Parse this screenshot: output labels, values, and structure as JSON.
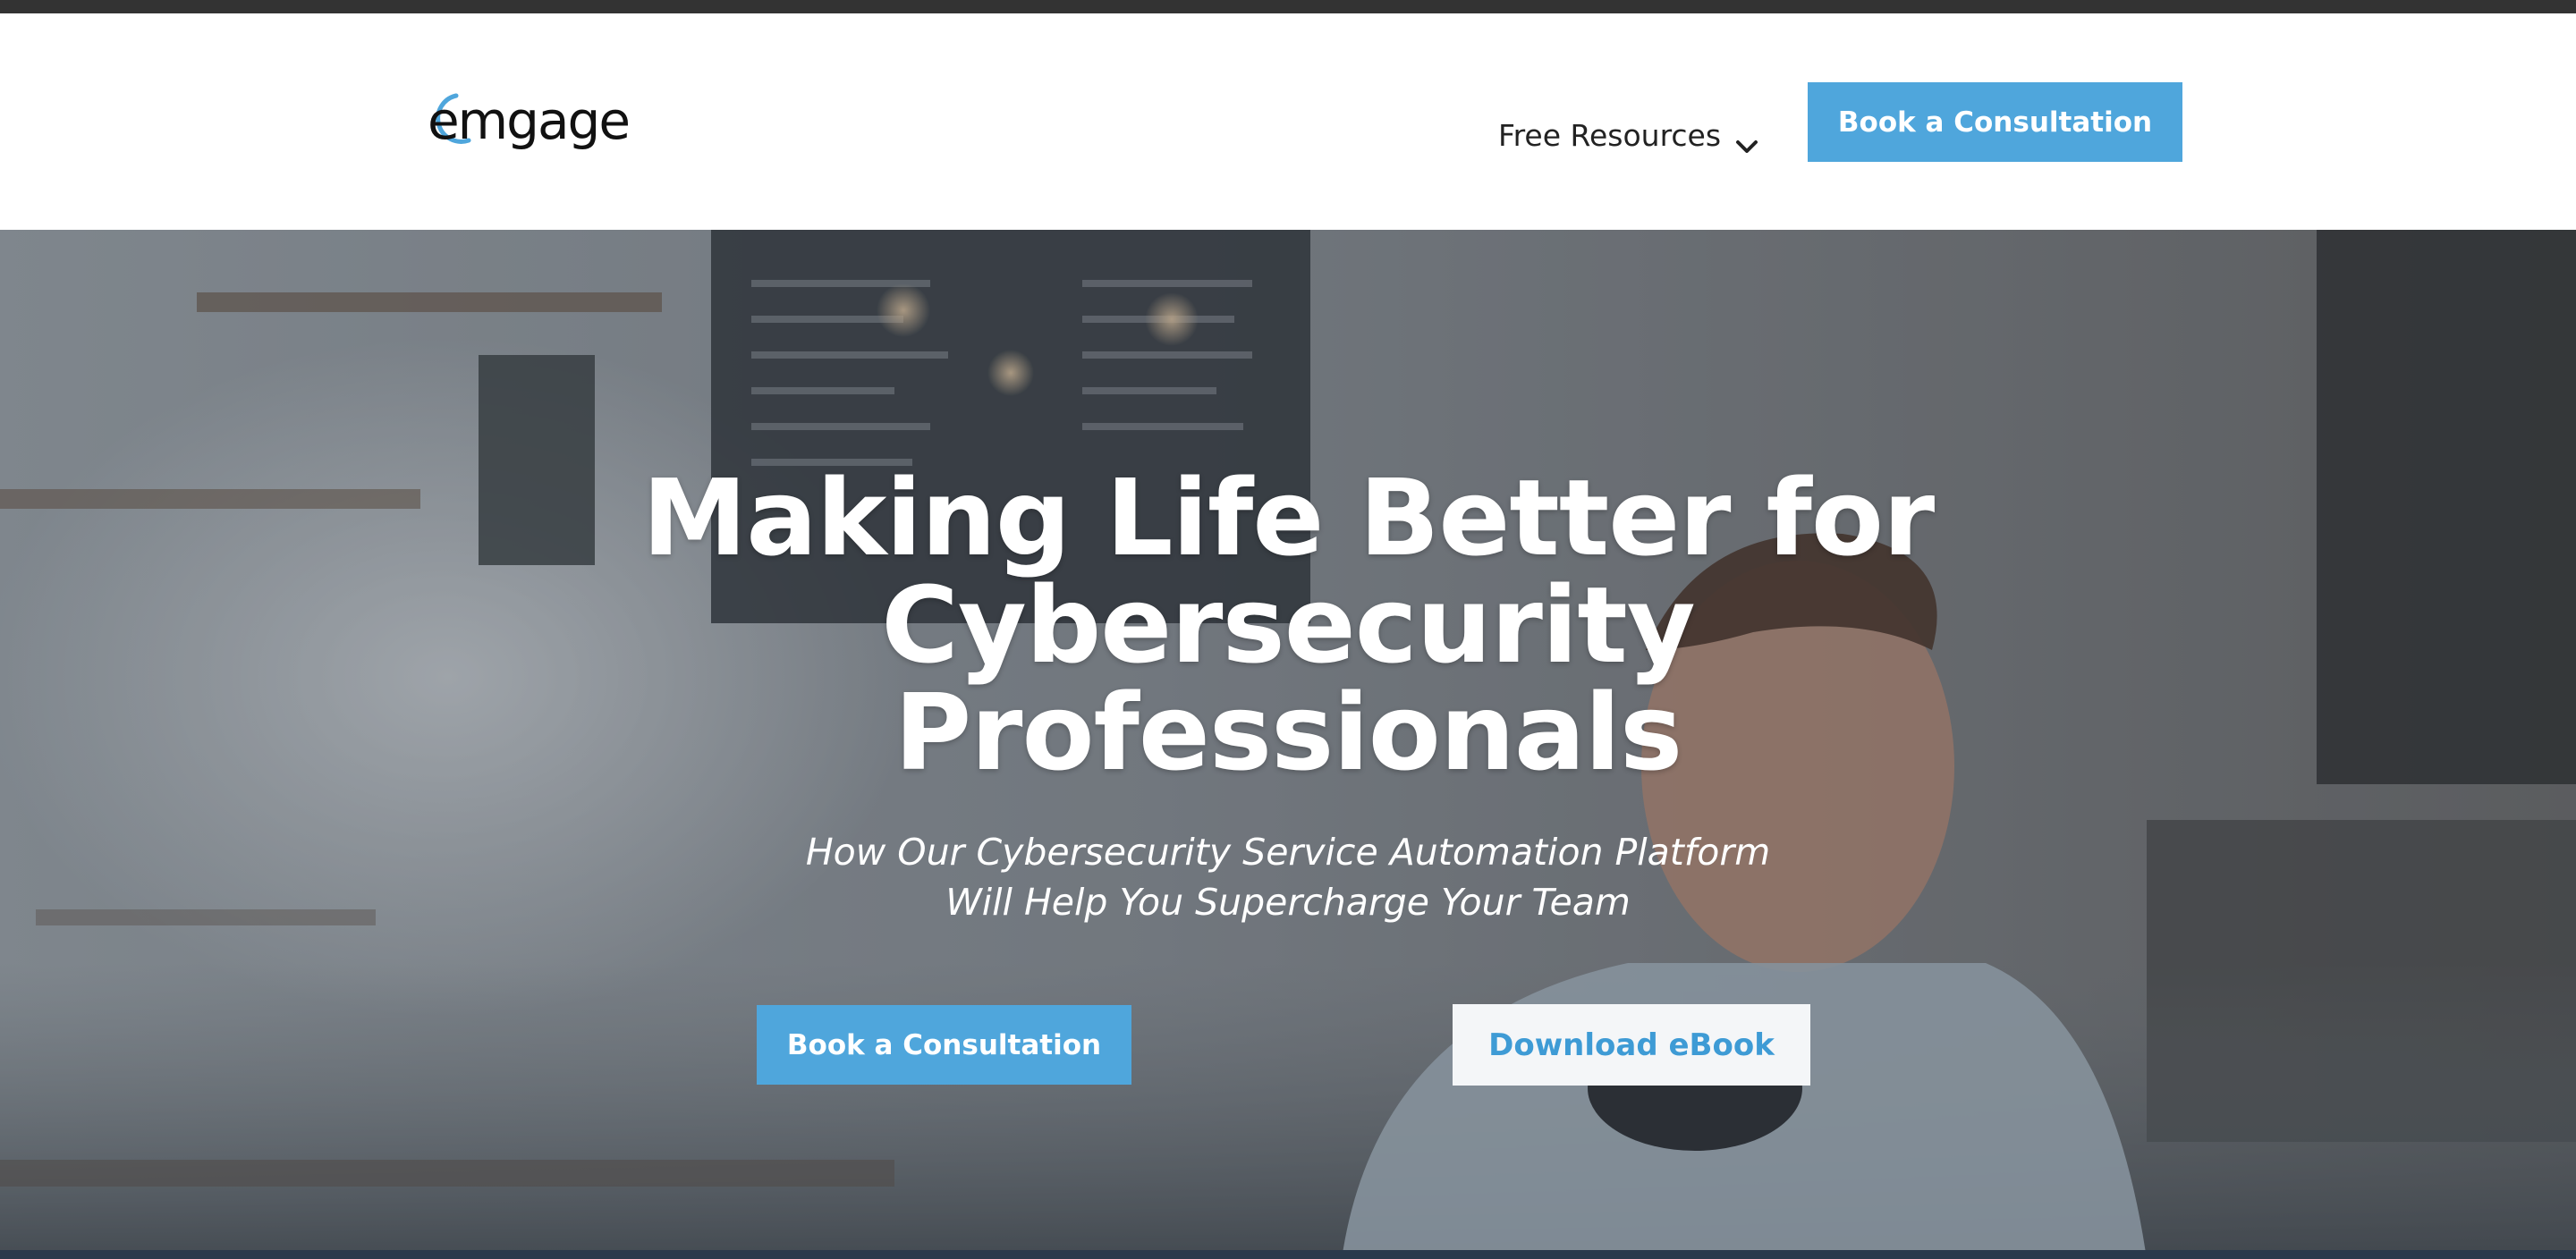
{
  "brand": {
    "logo_text": "emgage",
    "accent_color": "#4fa6dc"
  },
  "nav": {
    "resources_label": "Free Resources",
    "resources_icon": "chevron-down-icon",
    "cta_label": "Book a Consultation"
  },
  "hero": {
    "title_lines": [
      "Making Life Better for",
      "Cybersecurity",
      "Professionals"
    ],
    "subtitle_lines": [
      "How Our Cybersecurity Service Automation Platform",
      "Will Help You Supercharge Your Team"
    ],
    "primary_cta": "Book a Consultation",
    "secondary_cta": "Download eBook"
  }
}
